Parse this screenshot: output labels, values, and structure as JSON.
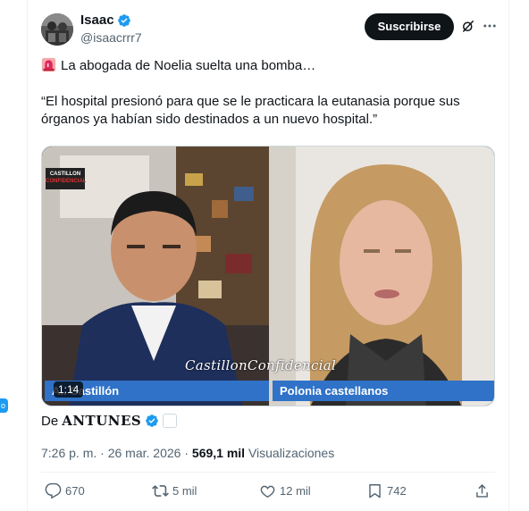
{
  "left_edge_tag": {
    "glyph": "o"
  },
  "author": {
    "display_name": "Isaac",
    "handle": "@isaacrrr7"
  },
  "header_actions": {
    "subscribe_label": "Suscribirse",
    "grok_icon": "grok-icon",
    "more_icon": "more-icon"
  },
  "tweet": {
    "line1": "La abogada de Noelia suelta una bomba…",
    "line1_emoji": "siren-emoji",
    "quote": "“El hospital presionó para que se le practicara la eutanasia porque sus órganos ya habían sido destinados a un nuevo hospital.”"
  },
  "media": {
    "logo_line1": "CASTILLON",
    "logo_line2": "CONFIDENCIAL",
    "watermark": "CastillonConfidencial",
    "left_name": "A.. Castillón",
    "right_name": "Polonia castellanos",
    "duration": "1:14"
  },
  "attribution": {
    "prefix": "De",
    "source": "ANTUNES"
  },
  "meta": {
    "time": "7:26 p. m.",
    "separator": "·",
    "date": "26 mar. 2026",
    "views_count": "569,1 mil",
    "views_label": "Visualizaciones"
  },
  "actions": {
    "replies": "670",
    "retweets": "5 mil",
    "likes": "12 mil",
    "bookmarks": "742"
  },
  "colors": {
    "accent": "#1d9bf0",
    "text": "#0f1419",
    "muted": "#536471",
    "lower_third": "#2f72c8"
  }
}
